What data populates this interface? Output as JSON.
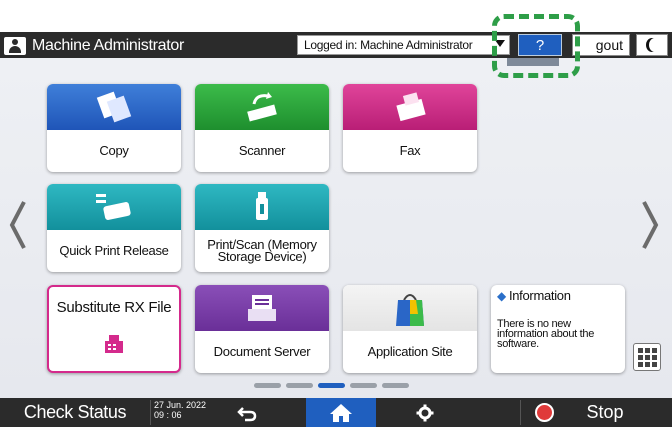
{
  "header": {
    "admin_title": "Machine Administrator",
    "logged_in_text": "Logged in: Machine Administrator",
    "help_label": "?",
    "logout_label": "gout"
  },
  "tiles": [
    {
      "label": "Copy",
      "icon": "copy-icon",
      "color": "#2a66c7"
    },
    {
      "label": "Scanner",
      "icon": "scanner-icon",
      "color": "#2aa63b"
    },
    {
      "label": "Fax",
      "icon": "fax-icon",
      "color": "#cc2f8a"
    },
    {
      "label": "Quick Print Release",
      "icon": "printer-icon",
      "color": "#1ea4af"
    },
    {
      "label": "Print/Scan (Memory Storage Device)",
      "icon": "usb-icon",
      "color": "#1ea4af"
    },
    {
      "label": "Substitute RX File",
      "icon": "fax-icon",
      "color": "#d42a8c"
    },
    {
      "label": "Document Server",
      "icon": "document-server-icon",
      "color": "#7a3fa8"
    },
    {
      "label": "Application Site",
      "icon": "shopping-bag-icon",
      "color": "#e8e8e8"
    }
  ],
  "info_widget": {
    "title": "Information",
    "body": "There is no new information about the software."
  },
  "pager": {
    "total": 5,
    "active": 3
  },
  "bottombar": {
    "check_status": "Check Status",
    "date": "27 Jun. 2022",
    "time": "09 : 06",
    "stop": "Stop"
  },
  "colors": {
    "accent": "#1f5fbf",
    "highlight": "#2e9e48"
  }
}
